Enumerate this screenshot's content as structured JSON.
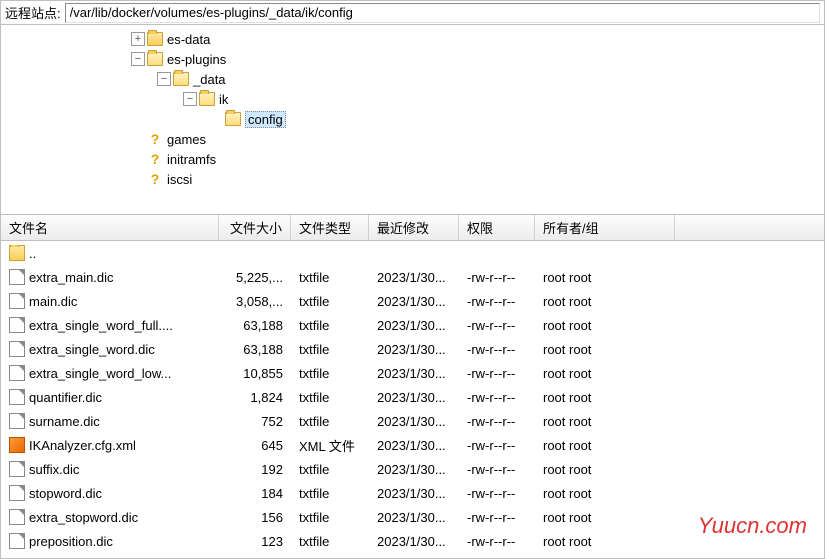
{
  "path_label": "远程站点:",
  "path_value": "/var/lib/docker/volumes/es-plugins/_data/ik/config",
  "tree": [
    {
      "indent": 30,
      "expander": "+",
      "icon": "folder",
      "label": "es-data"
    },
    {
      "indent": 30,
      "expander": "−",
      "icon": "folder-open",
      "label": "es-plugins"
    },
    {
      "indent": 56,
      "expander": "−",
      "icon": "folder-open",
      "label": "_data"
    },
    {
      "indent": 82,
      "expander": "−",
      "icon": "folder-open",
      "label": "ik"
    },
    {
      "indent": 108,
      "expander": " ",
      "icon": "folder-open",
      "label": "config",
      "selected": true
    },
    {
      "indent": 30,
      "expander": " ",
      "icon": "qmark",
      "label": "games"
    },
    {
      "indent": 30,
      "expander": " ",
      "icon": "qmark",
      "label": "initramfs"
    },
    {
      "indent": 30,
      "expander": " ",
      "icon": "qmark",
      "label": "iscsi"
    }
  ],
  "columns": {
    "name": "文件名",
    "size": "文件大小",
    "type": "文件类型",
    "date": "最近修改",
    "perm": "权限",
    "owner": "所有者/组"
  },
  "files": [
    {
      "icon": "folder",
      "name": "..",
      "size": "",
      "type": "",
      "date": "",
      "perm": "",
      "owner": ""
    },
    {
      "icon": "txt",
      "name": "extra_main.dic",
      "size": "5,225,...",
      "type": "txtfile",
      "date": "2023/1/30...",
      "perm": "-rw-r--r--",
      "owner": "root root"
    },
    {
      "icon": "txt",
      "name": "main.dic",
      "size": "3,058,...",
      "type": "txtfile",
      "date": "2023/1/30...",
      "perm": "-rw-r--r--",
      "owner": "root root"
    },
    {
      "icon": "txt",
      "name": "extra_single_word_full....",
      "size": "63,188",
      "type": "txtfile",
      "date": "2023/1/30...",
      "perm": "-rw-r--r--",
      "owner": "root root"
    },
    {
      "icon": "txt",
      "name": "extra_single_word.dic",
      "size": "63,188",
      "type": "txtfile",
      "date": "2023/1/30...",
      "perm": "-rw-r--r--",
      "owner": "root root"
    },
    {
      "icon": "txt",
      "name": "extra_single_word_low...",
      "size": "10,855",
      "type": "txtfile",
      "date": "2023/1/30...",
      "perm": "-rw-r--r--",
      "owner": "root root"
    },
    {
      "icon": "txt",
      "name": "quantifier.dic",
      "size": "1,824",
      "type": "txtfile",
      "date": "2023/1/30...",
      "perm": "-rw-r--r--",
      "owner": "root root"
    },
    {
      "icon": "txt",
      "name": "surname.dic",
      "size": "752",
      "type": "txtfile",
      "date": "2023/1/30...",
      "perm": "-rw-r--r--",
      "owner": "root root"
    },
    {
      "icon": "xml",
      "name": "IKAnalyzer.cfg.xml",
      "size": "645",
      "type": "XML 文件",
      "date": "2023/1/30...",
      "perm": "-rw-r--r--",
      "owner": "root root"
    },
    {
      "icon": "txt",
      "name": "suffix.dic",
      "size": "192",
      "type": "txtfile",
      "date": "2023/1/30...",
      "perm": "-rw-r--r--",
      "owner": "root root"
    },
    {
      "icon": "txt",
      "name": "stopword.dic",
      "size": "184",
      "type": "txtfile",
      "date": "2023/1/30...",
      "perm": "-rw-r--r--",
      "owner": "root root"
    },
    {
      "icon": "txt",
      "name": "extra_stopword.dic",
      "size": "156",
      "type": "txtfile",
      "date": "2023/1/30...",
      "perm": "-rw-r--r--",
      "owner": "root root"
    },
    {
      "icon": "txt",
      "name": "preposition.dic",
      "size": "123",
      "type": "txtfile",
      "date": "2023/1/30...",
      "perm": "-rw-r--r--",
      "owner": "root root"
    }
  ],
  "watermark": "Yuucn.com"
}
